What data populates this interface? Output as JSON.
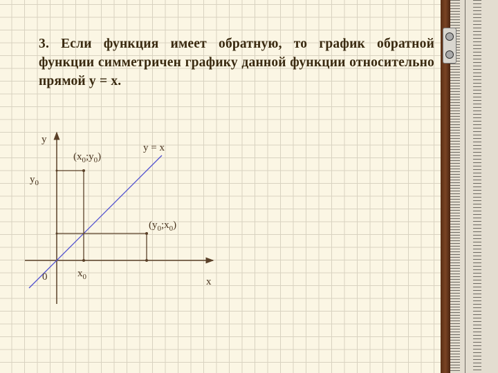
{
  "slide": {
    "statement": "3. Если функция имеет обратную, то график обратной функции симметричен графику данной функции относительно прямой y = x."
  },
  "diagram": {
    "axis_x_label": "x",
    "axis_y_label": "y",
    "origin_label": "0",
    "x0_label": "x",
    "x0_sub": "0",
    "y0_label": "y",
    "y0_sub": "0",
    "line_label": "y = x",
    "point1": {
      "open": "(x",
      "s1": "0",
      "mid": ";y",
      "s2": "0",
      "close": ")"
    },
    "point2": {
      "open": "(y",
      "s1": "0",
      "mid": ";x",
      "s2": "0",
      "close": ")"
    },
    "colors": {
      "axes": "#5a4028",
      "line": "#5050d0"
    }
  }
}
